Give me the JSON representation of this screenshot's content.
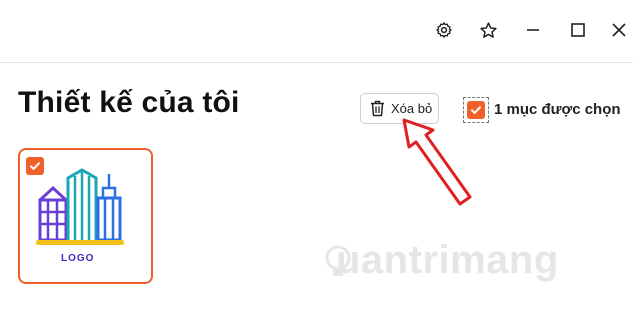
{
  "window": {
    "controls": {
      "settings_icon": "gear-icon",
      "favorite_icon": "star-icon",
      "minimize_icon": "minimize-icon",
      "maximize_icon": "maximize-icon",
      "close_icon": "close-icon"
    }
  },
  "page": {
    "title": "Thiết kế của tôi"
  },
  "toolbar": {
    "delete_label": "Xóa bỏ",
    "delete_icon": "trash-icon",
    "selection_label": "1 mục được chọn",
    "selection_checked": true
  },
  "designs": [
    {
      "thumbnail_text": "LOGO",
      "checked": true
    }
  ],
  "watermark": {
    "text": "uantrimang"
  },
  "colors": {
    "accent": "#f0602a",
    "arrow": "#e02020",
    "logo_text": "#3d2bbf"
  }
}
